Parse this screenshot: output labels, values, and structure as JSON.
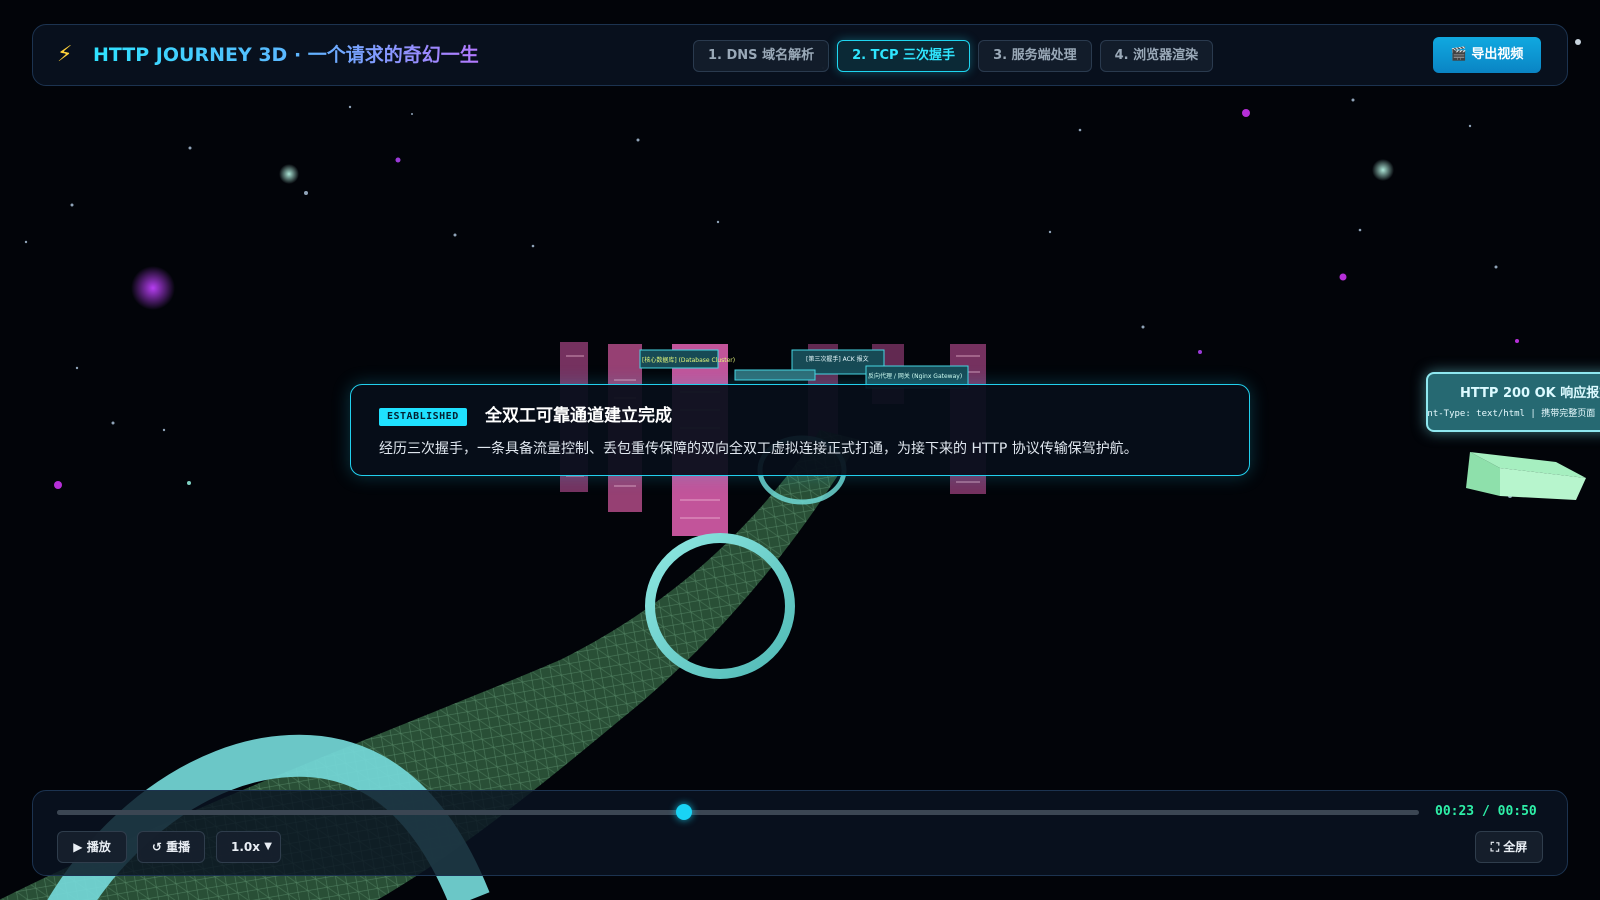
{
  "header": {
    "bolt_icon": "⚡",
    "title": "HTTP JOURNEY 3D · 一个请求的奇幻一生",
    "tabs": [
      {
        "label": "1. DNS 域名解析",
        "active": false
      },
      {
        "label": "2. TCP 三次握手",
        "active": true
      },
      {
        "label": "3. 服务端处理",
        "active": false
      },
      {
        "label": "4. 浏览器渲染",
        "active": false
      }
    ],
    "export_label": "🎬 导出视频"
  },
  "info_card": {
    "tag": "ESTABLISHED",
    "title": "全双工可靠通道建立完成",
    "description": "经历三次握手，一条具备流量控制、丢包重传保障的双向全双工虚拟连接正式打通，为接下来的 HTTP 协议传输保驾护航。"
  },
  "scene": {
    "side_label_title": "HTTP 200 OK 响应报文",
    "side_label_sub": "ent-Type: text/html | 携带完整页面",
    "server_sign_1": "[核心数据库] (Database Cluster)",
    "server_sign_2": "[第三次握手] ACK 报文",
    "server_sign_3": "反向代理 / 网关 (Nginx Gateway)"
  },
  "controls": {
    "progress": 0.46,
    "time": "00:23 / 00:50",
    "play_label": "▶ 播放",
    "replay_label": "↺ 重播",
    "speed_value": "1.0x",
    "fullscreen_label": "⛶ 全屏"
  },
  "colors": {
    "accent": "#1fd6f0",
    "time": "#2ef0a8",
    "tube": "#2f5a3c",
    "ring": "#6fd8d4"
  }
}
